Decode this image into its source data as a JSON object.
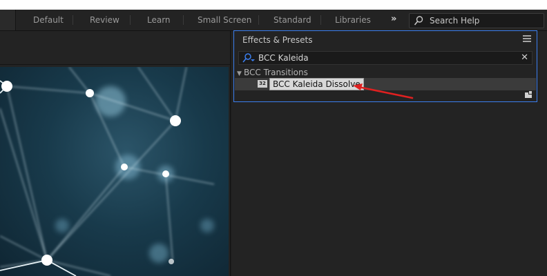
{
  "workspace": {
    "tabs": [
      "Default",
      "Review",
      "Learn",
      "Small Screen",
      "Standard",
      "Libraries"
    ],
    "overflow_glyph": "»",
    "search_placeholder": "Search Help"
  },
  "effects_panel": {
    "title": "Effects & Presets",
    "search_value": "BCC Kaleida",
    "category": "BCC Transitions",
    "item_badge": "32",
    "item_label": "BCC Kaleida Dissolve"
  },
  "colors": {
    "accent": "#3b7ff0",
    "annotation_arrow": "#e02020"
  },
  "icons": [
    "search-icon",
    "panel-menu-icon",
    "clear-icon",
    "disclosure-triangle-icon",
    "effect-preset-icon",
    "new-folder-icon",
    "chevron-double-right-icon"
  ]
}
